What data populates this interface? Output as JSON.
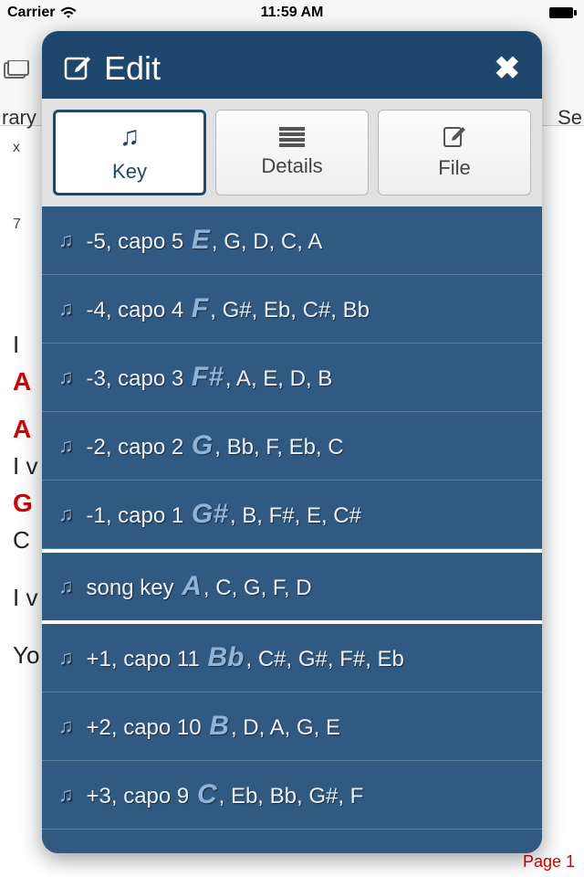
{
  "status": {
    "carrier": "Carrier",
    "time": "11:59 AM"
  },
  "under": {
    "leftFragment": "rary",
    "rightFragment": "Se"
  },
  "bg": {
    "line1": "I",
    "red1": "A",
    "red2": "A",
    "line3": "I v",
    "red3": "G",
    "line4": "C",
    "line6": "I v",
    "line8": "Yo",
    "chord1": "x",
    "chord2": "7"
  },
  "pageLabel": "Page 1",
  "modal": {
    "title": "Edit",
    "tabs": {
      "key": "Key",
      "details": "Details",
      "file": "File"
    },
    "keys": [
      {
        "prefix": "-5, capo 5",
        "root": "E",
        "rest": ", G, D, C, A"
      },
      {
        "prefix": "-4, capo 4",
        "root": "F",
        "rest": ", G#, Eb, C#, Bb"
      },
      {
        "prefix": "-3, capo 3",
        "root": "F#",
        "rest": ", A, E, D, B"
      },
      {
        "prefix": "-2, capo 2",
        "root": "G",
        "rest": ", Bb, F, Eb, C"
      },
      {
        "prefix": "-1, capo 1",
        "root": "G#",
        "rest": ", B, F#, E, C#"
      },
      {
        "prefix": "song key",
        "root": "A",
        "rest": ", C, G, F, D",
        "current": true
      },
      {
        "prefix": "+1, capo 11",
        "root": "Bb",
        "rest": ", C#, G#, F#, Eb"
      },
      {
        "prefix": "+2, capo 10",
        "root": "B",
        "rest": ", D, A, G, E"
      },
      {
        "prefix": "+3, capo 9",
        "root": "C",
        "rest": ", Eb, Bb, G#, F"
      }
    ]
  }
}
